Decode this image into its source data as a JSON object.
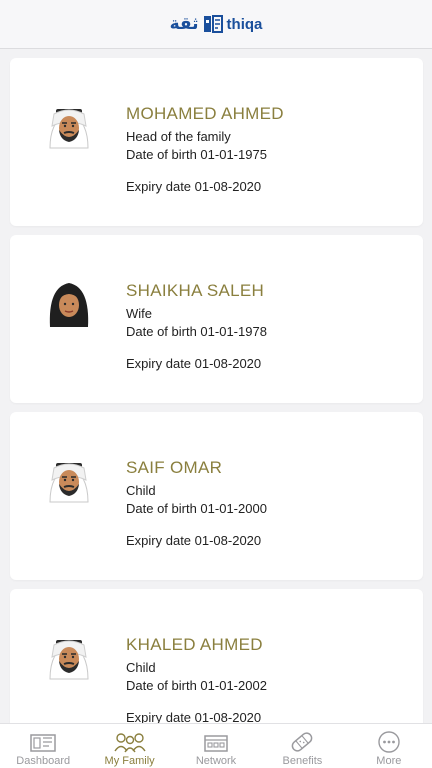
{
  "header": {
    "logo_arabic": "ثقة",
    "logo_english": "thiqa",
    "logo_icon": "thiqa-logo-mark"
  },
  "members": [
    {
      "name": "MOHAMED AHMED",
      "relation": "Head of the family",
      "dob": "Date of birth 01-01-1975",
      "expiry": "Expiry date 01-08-2020",
      "avatar": "man-ghutra-avatar"
    },
    {
      "name": "SHAIKHA SALEH",
      "relation": "Wife",
      "dob": "Date of birth 01-01-1978",
      "expiry": "Expiry date 01-08-2020",
      "avatar": "woman-hijab-avatar"
    },
    {
      "name": "SAIF OMAR",
      "relation": "Child",
      "dob": "Date of birth 01-01-2000",
      "expiry": "Expiry date 01-08-2020",
      "avatar": "man-ghutra-avatar"
    },
    {
      "name": "KHALED AHMED",
      "relation": "Child",
      "dob": "Date of birth 01-01-2002",
      "expiry": "Expiry date 01-08-2020",
      "avatar": "man-ghutra-avatar"
    }
  ],
  "tabs": [
    {
      "label": "Dashboard",
      "icon": "dashboard-icon",
      "active": false
    },
    {
      "label": "My Family",
      "icon": "family-icon",
      "active": true
    },
    {
      "label": "Network",
      "icon": "network-building-icon",
      "active": false
    },
    {
      "label": "Benefits",
      "icon": "bandage-icon",
      "active": false
    },
    {
      "label": "More",
      "icon": "more-dots-icon",
      "active": false
    }
  ],
  "colors": {
    "accent": "#8a7f3e",
    "brand": "#1a4f9c",
    "inactive": "#9a9a9e"
  }
}
